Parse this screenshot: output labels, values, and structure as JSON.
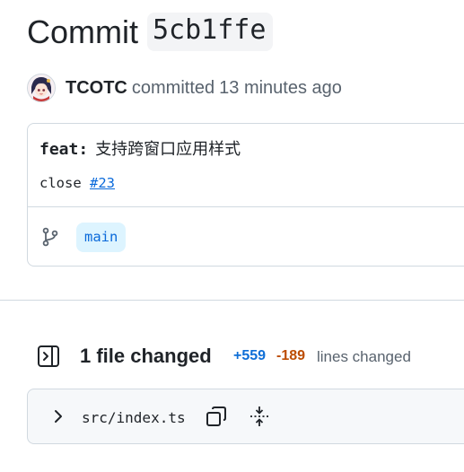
{
  "header": {
    "title_word": "Commit",
    "sha": "5cb1ffe"
  },
  "author": {
    "name": "TCOTC",
    "action": "committed",
    "time": "13 minutes ago"
  },
  "commit": {
    "message_prefix": "feat:",
    "message_title": "支持跨窗口应用样式",
    "body_text": "close",
    "issue_ref": "#23",
    "branch": "main"
  },
  "files": {
    "changed_label": "1 file changed",
    "additions": "+559",
    "deletions": "-189",
    "lines_label": "lines changed",
    "list": [
      {
        "path": "src/index.ts"
      }
    ]
  },
  "icons": {
    "branch": "git-branch-icon",
    "tree_toggle": "sidebar-toggle-icon",
    "chevron": "chevron-right-icon",
    "copy": "copy-icon",
    "expand": "expand-icon"
  },
  "colors": {
    "link": "#0969da",
    "branch_bg": "#ddf4ff",
    "additions": "#0f6fd7",
    "deletions": "#bc4c00",
    "muted": "#59636e"
  }
}
